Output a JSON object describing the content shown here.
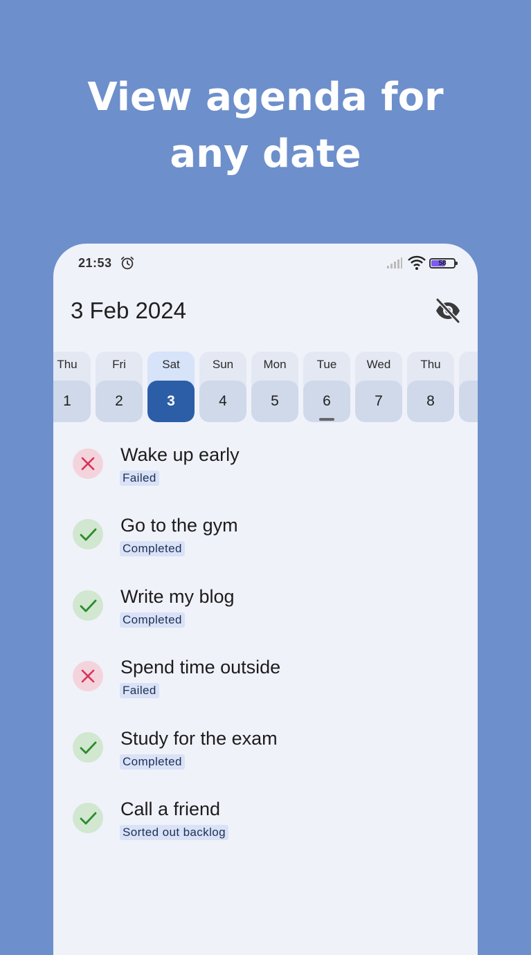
{
  "headline": "View agenda for any date",
  "status_bar": {
    "time": "21:53",
    "battery": "58",
    "battery_level": 0.58,
    "icons": [
      "alarm-icon",
      "signal-icon",
      "wifi-icon",
      "battery-icon"
    ]
  },
  "header": {
    "date_title": "3 Feb 2024",
    "hide_icon": "eye-off-icon"
  },
  "days": [
    {
      "name": "Thu",
      "num": "1",
      "selected": false,
      "today": false
    },
    {
      "name": "Fri",
      "num": "2",
      "selected": false,
      "today": false
    },
    {
      "name": "Sat",
      "num": "3",
      "selected": true,
      "today": false
    },
    {
      "name": "Sun",
      "num": "4",
      "selected": false,
      "today": false
    },
    {
      "name": "Mon",
      "num": "5",
      "selected": false,
      "today": false
    },
    {
      "name": "Tue",
      "num": "6",
      "selected": false,
      "today": true
    },
    {
      "name": "Wed",
      "num": "7",
      "selected": false,
      "today": false
    },
    {
      "name": "Thu",
      "num": "8",
      "selected": false,
      "today": false
    },
    {
      "name": "",
      "num": "",
      "selected": false,
      "today": false
    }
  ],
  "tasks": [
    {
      "title": "Wake up early",
      "status": "Failed",
      "state": "failed"
    },
    {
      "title": "Go to the gym",
      "status": "Completed",
      "state": "done"
    },
    {
      "title": "Write my blog",
      "status": "Completed",
      "state": "done"
    },
    {
      "title": "Spend time outside",
      "status": "Failed",
      "state": "failed"
    },
    {
      "title": "Study for the exam",
      "status": "Completed",
      "state": "done"
    },
    {
      "title": "Call a friend",
      "status": "Sorted out backlog",
      "state": "done"
    }
  ],
  "colors": {
    "background": "#6d8fcb",
    "selected_day": "#2c5ea8",
    "failed": "#d6345a",
    "done": "#2e8a2e"
  }
}
